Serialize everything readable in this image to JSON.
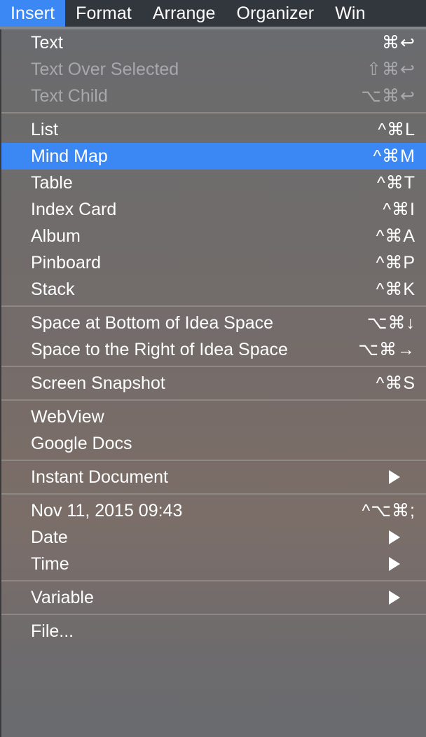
{
  "menubar": {
    "items": [
      {
        "label": "Insert",
        "active": true
      },
      {
        "label": "Format",
        "active": false
      },
      {
        "label": "Arrange",
        "active": false
      },
      {
        "label": "Organizer",
        "active": false
      },
      {
        "label": "Win",
        "active": false
      }
    ]
  },
  "colors": {
    "accent": "#3b88f5",
    "menubar_bg": "#32373d",
    "panel_top": "#6a6b6e",
    "panel_warm": "#7b6e69",
    "text": "#ffffff",
    "text_disabled": "#a7a8ab",
    "separator": "#8e8884"
  },
  "menu": {
    "title": "Insert",
    "groups": [
      {
        "items": [
          {
            "label": "Text",
            "shortcut": "⌘↩",
            "disabled": false,
            "selected": false,
            "submenu": false
          },
          {
            "label": "Text Over Selected",
            "shortcut": "⇧⌘↩",
            "disabled": true,
            "selected": false,
            "submenu": false
          },
          {
            "label": "Text Child",
            "shortcut": "⌥⌘↩",
            "disabled": true,
            "selected": false,
            "submenu": false
          }
        ]
      },
      {
        "items": [
          {
            "label": "List",
            "shortcut": "^⌘L",
            "disabled": false,
            "selected": false,
            "submenu": false
          },
          {
            "label": "Mind Map",
            "shortcut": "^⌘M",
            "disabled": false,
            "selected": true,
            "submenu": false
          },
          {
            "label": "Table",
            "shortcut": "^⌘T",
            "disabled": false,
            "selected": false,
            "submenu": false
          },
          {
            "label": "Index Card",
            "shortcut": "^⌘I",
            "disabled": false,
            "selected": false,
            "submenu": false
          },
          {
            "label": "Album",
            "shortcut": "^⌘A",
            "disabled": false,
            "selected": false,
            "submenu": false
          },
          {
            "label": "Pinboard",
            "shortcut": "^⌘P",
            "disabled": false,
            "selected": false,
            "submenu": false
          },
          {
            "label": "Stack",
            "shortcut": "^⌘K",
            "disabled": false,
            "selected": false,
            "submenu": false
          }
        ]
      },
      {
        "items": [
          {
            "label": "Space at Bottom of Idea Space",
            "shortcut": "⌥⌘↓",
            "disabled": false,
            "selected": false,
            "submenu": false
          },
          {
            "label": "Space to the Right of Idea Space",
            "shortcut": "⌥⌘→",
            "disabled": false,
            "selected": false,
            "submenu": false
          }
        ]
      },
      {
        "items": [
          {
            "label": "Screen Snapshot",
            "shortcut": "^⌘S",
            "disabled": false,
            "selected": false,
            "submenu": false
          }
        ]
      },
      {
        "items": [
          {
            "label": "WebView",
            "shortcut": "",
            "disabled": false,
            "selected": false,
            "submenu": false
          },
          {
            "label": "Google Docs",
            "shortcut": "",
            "disabled": false,
            "selected": false,
            "submenu": false
          }
        ]
      },
      {
        "items": [
          {
            "label": "Instant Document",
            "shortcut": "",
            "disabled": false,
            "selected": false,
            "submenu": true
          }
        ]
      },
      {
        "items": [
          {
            "label": "Nov 11, 2015 09:43",
            "shortcut": "^⌥⌘;",
            "disabled": false,
            "selected": false,
            "submenu": false
          },
          {
            "label": "Date",
            "shortcut": "",
            "disabled": false,
            "selected": false,
            "submenu": true
          },
          {
            "label": "Time",
            "shortcut": "",
            "disabled": false,
            "selected": false,
            "submenu": true
          }
        ]
      },
      {
        "items": [
          {
            "label": "Variable",
            "shortcut": "",
            "disabled": false,
            "selected": false,
            "submenu": true
          }
        ]
      },
      {
        "items": [
          {
            "label": "File...",
            "shortcut": "",
            "disabled": false,
            "selected": false,
            "submenu": false
          }
        ]
      }
    ]
  }
}
